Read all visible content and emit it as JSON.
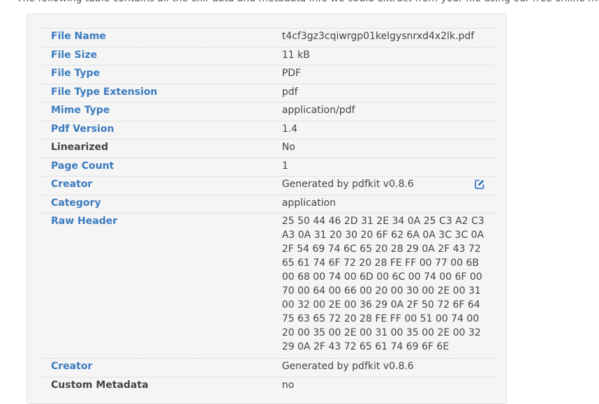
{
  "intro_text": "The following table contains all the exif data and metadata info we could extract from your file using our free online me",
  "rows": [
    {
      "key": "File Name",
      "value": "t4cf3gz3cqiwrgp01kelgysnrxd4x2lk.pdf"
    },
    {
      "key": "File Size",
      "value": "11 kB"
    },
    {
      "key": "File Type",
      "value": "PDF"
    },
    {
      "key": "File Type Extension",
      "value": "pdf"
    },
    {
      "key": "Mime Type",
      "value": "application/pdf"
    },
    {
      "key": "Pdf Version",
      "value": "1.4"
    },
    {
      "key": "Linearized",
      "value": "No"
    },
    {
      "key": "Page Count",
      "value": "1"
    },
    {
      "key": "Creator",
      "value": "Generated by pdfkit v0.8.6",
      "icon": "edit-icon"
    },
    {
      "key": "Category",
      "value": "application"
    },
    {
      "key": "Raw Header",
      "value": "25 50 44 46 2D 31 2E 34 0A 25 C3 A2 C3 A3 0A 31 20 30 20 6F 62 6A 0A 3C 3C 0A 2F 54 69 74 6C 65 20 28 29 0A 2F 43 72 65 61 74 6F 72 20 28 FE FF 00 77 00 6B 00 68 00 74 00 6D 00 6C 00 74 00 6F 00 70 00 64 00 66 00 20 00 30 00 2E 00 31 00 32 00 2E 00 36 29 0A 2F 50 72 6F 64 75 63 65 72 20 28 FE FF 00 51 00 74 00 20 00 35 00 2E 00 31 00 35 00 2E 00 32 29 0A 2F 43 72 65 61 74 69 6F 6E"
    },
    {
      "key": "Creator",
      "value": "Generated by pdfkit v0.8.6"
    },
    {
      "key": "Custom Metadata",
      "value": "no"
    }
  ],
  "colors": {
    "link_key": "#3a7bbf",
    "dark_key": "#444444",
    "panel_bg": "#f5f5f5"
  }
}
